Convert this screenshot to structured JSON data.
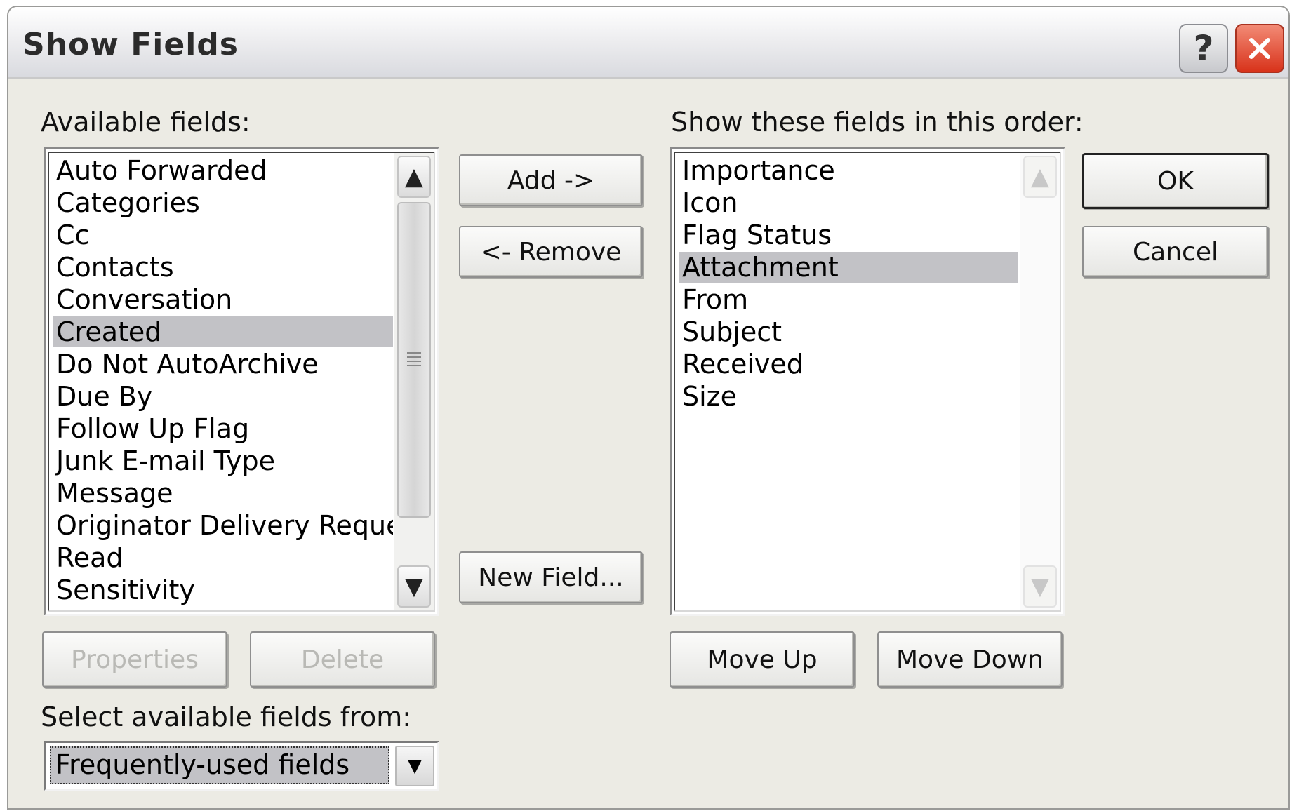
{
  "window": {
    "title": "Show Fields",
    "help_glyph": "?",
    "close_glyph": "✕"
  },
  "available": {
    "label": "Available fields:",
    "items": [
      "Auto Forwarded",
      "Categories",
      "Cc",
      "Contacts",
      "Conversation",
      "Created",
      "Do Not AutoArchive",
      "Due By",
      "Follow Up Flag",
      "Junk E-mail Type",
      "Message",
      "Originator Delivery Requeste",
      "Read",
      "Sensitivity"
    ],
    "selected_index": 5
  },
  "shown": {
    "label": "Show these fields in this order:",
    "items": [
      "Importance",
      "Icon",
      "Flag Status",
      "Attachment",
      "From",
      "Subject",
      "Received",
      "Size"
    ],
    "selected_index": 3
  },
  "buttons": {
    "add": "Add ->",
    "remove": "<- Remove",
    "new_field": "New Field...",
    "properties": "Properties",
    "delete": "Delete",
    "move_up": "Move Up",
    "move_down": "Move Down",
    "ok": "OK",
    "cancel": "Cancel"
  },
  "source": {
    "label": "Select available fields from:",
    "value": "Frequently-used fields"
  },
  "icons": {
    "scroll_up": "▲",
    "scroll_down": "▼",
    "dropdown": "▼"
  }
}
